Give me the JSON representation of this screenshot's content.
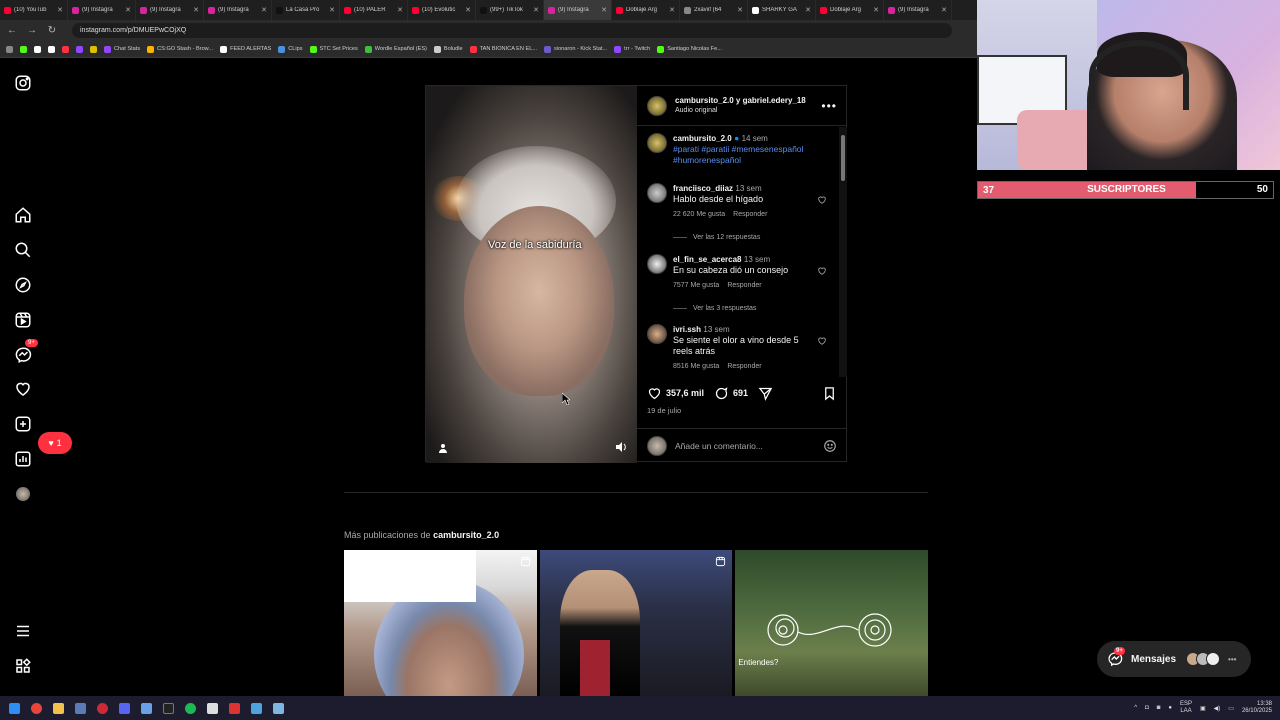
{
  "browser": {
    "tabs": [
      {
        "label": "(10) YouTub",
        "color": "#ff0033"
      },
      {
        "label": "(9) Instagra",
        "color": "#d6249f"
      },
      {
        "label": "(9) Instagra",
        "color": "#d6249f"
      },
      {
        "label": "(9) Instagra",
        "color": "#d6249f"
      },
      {
        "label": "La Casa Pro",
        "color": "#111111"
      },
      {
        "label": "(10) PALER",
        "color": "#ff0033"
      },
      {
        "label": "(10) Evolutic",
        "color": "#ff0033"
      },
      {
        "label": "(99+) TikTok",
        "color": "#111111"
      },
      {
        "label": "(9) Instagra",
        "color": "#d6249f"
      },
      {
        "label": "Doblaje Arg",
        "color": "#ff0033"
      },
      {
        "label": "2xaviif (64",
        "color": "#888888"
      },
      {
        "label": "SHARKY GA",
        "color": "#ffffff"
      },
      {
        "label": "Doblaje Arg",
        "color": "#ff0033"
      },
      {
        "label": "(9) Instagra",
        "color": "#d6249f"
      }
    ],
    "url": "instagram.com/p/DMUEPwCOjXQ",
    "bookmarks": [
      "Chat Stats",
      "CS:GO Stash - Brow...",
      "FEED ALERTAS",
      "CLips",
      "STC Set Prices",
      "Wordle Español (ES)",
      "Boludle",
      "TAN BIONICA EN EL...",
      "sionaron - Kick Stat...",
      "trr - Twitch",
      "Santiago Nicolas Fe..."
    ]
  },
  "sidebar": {
    "activity_badge": "9+",
    "notifications_count": "1"
  },
  "post": {
    "header_users": "cambursito_2.0 y gabriel.edery_18",
    "audio": "Audio original",
    "video_caption": "Voz de la sabiduría",
    "caption": {
      "user": "cambursito_2.0",
      "when": "14 sem",
      "tags": "#parati #paratii #memesenespañol #humorenespañol"
    },
    "comments": [
      {
        "user": "franciisco_diiaz",
        "when": "13 sem",
        "body": "Hablo desde el hígado",
        "likes": "22 620 Me gusta",
        "reply": "Responder",
        "replies": "Ver las 12 respuestas"
      },
      {
        "user": "el_fin_se_acerca8",
        "when": "13 sem",
        "body": "En su cabeza dió un consejo",
        "likes": "7577 Me gusta",
        "reply": "Responder",
        "replies": "Ver las 3 respuestas"
      },
      {
        "user": "ivri.ssh",
        "when": "13 sem",
        "body": "Se siente el olor a vino desde 5 reels atrás",
        "likes": "8516 Me gusta",
        "reply": "Responder"
      }
    ],
    "like_count": "357,6 mil",
    "comment_count": "691",
    "date": "19 de julio",
    "add_comment_placeholder": "Añade un comentario..."
  },
  "more_posts": {
    "prefix": "Más publicaciones de",
    "user": "cambursito_2.0",
    "third_caption": "Entiendes?"
  },
  "messages": {
    "label": "Mensajes",
    "badge": "9+"
  },
  "taskbar": {
    "lang_top": "ESP",
    "lang_bottom": "LAA",
    "time": "13:38",
    "date": "26/10/2025"
  },
  "stream_overlay": {
    "sub_current": "37",
    "sub_label": "SUSCRIPTORES",
    "sub_goal": "50",
    "progress_fraction": 0.74,
    "bar_color": "#e35b6f"
  }
}
